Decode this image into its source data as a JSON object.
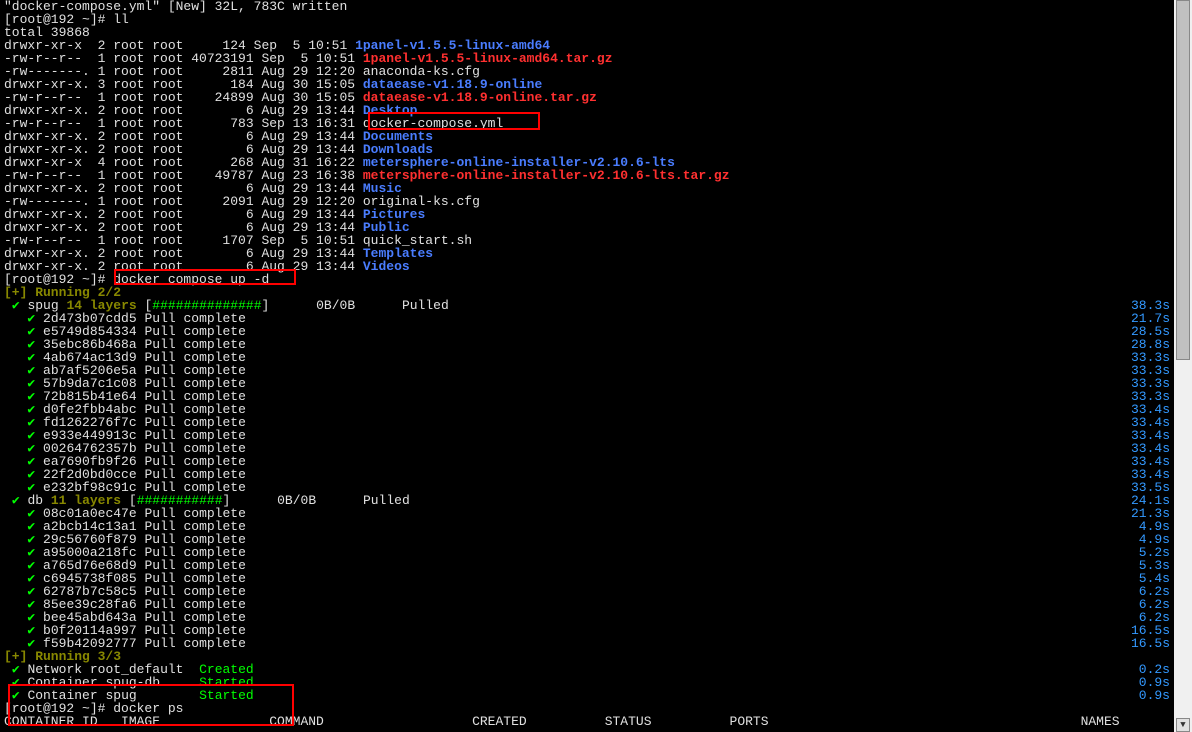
{
  "header": "\"docker-compose.yml\" [New] 32L, 783C written",
  "prompt1": "[root@192 ~]# ll",
  "total": "total 39868",
  "files": [
    {
      "perm": "drwxr-xr-x",
      "n": "2",
      "o": "root root",
      "sz": "    124",
      "dt": "Sep  5 10:51",
      "nm": "1panel-v1.5.5-linux-amd64",
      "c": "b"
    },
    {
      "perm": "-rw-r--r--",
      "n": "1",
      "o": "root root",
      "sz": "40723191",
      "dt": "Sep  5 10:51",
      "nm": "1panel-v1.5.5-linux-amd64.tar.gz",
      "c": "r"
    },
    {
      "perm": "-rw-------.",
      "n": "1",
      "o": "root root",
      "sz": "    2811",
      "dt": "Aug 29 12:20",
      "nm": "anaconda-ks.cfg",
      "c": "w"
    },
    {
      "perm": "drwxr-xr-x.",
      "n": "3",
      "o": "root root",
      "sz": "     184",
      "dt": "Aug 30 15:05",
      "nm": "dataease-v1.18.9-online",
      "c": "b"
    },
    {
      "perm": "-rw-r--r--",
      "n": "1",
      "o": "root root",
      "sz": "   24899",
      "dt": "Aug 30 15:05",
      "nm": "dataease-v1.18.9-online.tar.gz",
      "c": "r"
    },
    {
      "perm": "drwxr-xr-x.",
      "n": "2",
      "o": "root root",
      "sz": "       6",
      "dt": "Aug 29 13:44",
      "nm": "Desktop",
      "c": "b"
    },
    {
      "perm": "-rw-r--r--",
      "n": "1",
      "o": "root root",
      "sz": "     783",
      "dt": "Sep 13 16:31",
      "nm": "docker-compose.yml",
      "c": "w",
      "hl": 1
    },
    {
      "perm": "drwxr-xr-x.",
      "n": "2",
      "o": "root root",
      "sz": "       6",
      "dt": "Aug 29 13:44",
      "nm": "Documents",
      "c": "b"
    },
    {
      "perm": "drwxr-xr-x.",
      "n": "2",
      "o": "root root",
      "sz": "       6",
      "dt": "Aug 29 13:44",
      "nm": "Downloads",
      "c": "b"
    },
    {
      "perm": "drwxr-xr-x",
      "n": "4",
      "o": "root root",
      "sz": "     268",
      "dt": "Aug 31 16:22",
      "nm": "metersphere-online-installer-v2.10.6-lts",
      "c": "b"
    },
    {
      "perm": "-rw-r--r--",
      "n": "1",
      "o": "root root",
      "sz": "   49787",
      "dt": "Aug 23 16:38",
      "nm": "metersphere-online-installer-v2.10.6-lts.tar.gz",
      "c": "r"
    },
    {
      "perm": "drwxr-xr-x.",
      "n": "2",
      "o": "root root",
      "sz": "       6",
      "dt": "Aug 29 13:44",
      "nm": "Music",
      "c": "b"
    },
    {
      "perm": "-rw-------.",
      "n": "1",
      "o": "root root",
      "sz": "    2091",
      "dt": "Aug 29 12:20",
      "nm": "original-ks.cfg",
      "c": "w"
    },
    {
      "perm": "drwxr-xr-x.",
      "n": "2",
      "o": "root root",
      "sz": "       6",
      "dt": "Aug 29 13:44",
      "nm": "Pictures",
      "c": "b"
    },
    {
      "perm": "drwxr-xr-x.",
      "n": "2",
      "o": "root root",
      "sz": "       6",
      "dt": "Aug 29 13:44",
      "nm": "Public",
      "c": "b"
    },
    {
      "perm": "-rw-r--r--",
      "n": "1",
      "o": "root root",
      "sz": "    1707",
      "dt": "Sep  5 10:51",
      "nm": "quick_start.sh",
      "c": "w"
    },
    {
      "perm": "drwxr-xr-x.",
      "n": "2",
      "o": "root root",
      "sz": "       6",
      "dt": "Aug 29 13:44",
      "nm": "Templates",
      "c": "b"
    },
    {
      "perm": "drwxr-xr-x.",
      "n": "2",
      "o": "root root",
      "sz": "       6",
      "dt": "Aug 29 13:44",
      "nm": "Videos",
      "c": "b"
    }
  ],
  "prompt2_a": "[root@192 ~]# ",
  "prompt2_b": "docker compose up -d",
  "running": "[+] Running 2/2",
  "spug_hdr_a": "spug ",
  "spug_hdr_b": "14 layers",
  " spug_hdr_c": " [",
  "spug_hdr_bar": "##############",
  "spug_hdr_d": "]      0B/0B      Pulled",
  "spug_hdr_t": "38.3s",
  "layers_spug": [
    {
      "h": "2d473b07cdd5",
      "t": "21.7s"
    },
    {
      "h": "e5749d854334",
      "t": "28.5s"
    },
    {
      "h": "35ebc86b468a",
      "t": "28.8s"
    },
    {
      "h": "4ab674ac13d9",
      "t": "33.3s"
    },
    {
      "h": "ab7af5206e5a",
      "t": "33.3s"
    },
    {
      "h": "57b9da7c1c08",
      "t": "33.3s"
    },
    {
      "h": "72b815b41e64",
      "t": "33.3s"
    },
    {
      "h": "d0fe2fbb4abc",
      "t": "33.4s"
    },
    {
      "h": "fd1262276f7c",
      "t": "33.4s"
    },
    {
      "h": "e933e449913c",
      "t": "33.4s"
    },
    {
      "h": "00264762357b",
      "t": "33.4s"
    },
    {
      "h": "ea7690fb9f26",
      "t": "33.4s"
    },
    {
      "h": "22f2d0bd0cce",
      "t": "33.4s"
    },
    {
      "h": "e232bf98c91c",
      "t": "33.5s"
    }
  ],
  "db_hdr_a": "db ",
  "db_hdr_b": "11 layers",
  "db_hdr_c": " [",
  "db_hdr_bar": "###########",
  "db_hdr_d": "]      0B/0B      Pulled",
  "db_hdr_t": "24.1s",
  "layers_db": [
    {
      "h": "08c01a0ec47e",
      "t": "21.3s"
    },
    {
      "h": "a2bcb14c13a1",
      "t": "4.9s"
    },
    {
      "h": "29c56760f879",
      "t": "4.9s"
    },
    {
      "h": "a95000a218fc",
      "t": "5.2s"
    },
    {
      "h": "a765d76e68d9",
      "t": "5.3s"
    },
    {
      "h": "c6945738f085",
      "t": "5.4s"
    },
    {
      "h": "62787b7c58c5",
      "t": "6.2s"
    },
    {
      "h": "85ee39c28fa6",
      "t": "6.2s"
    },
    {
      "h": "bee45abd643a",
      "t": "6.2s"
    },
    {
      "h": "b0f20114a997",
      "t": "16.5s"
    },
    {
      "h": "f59b42092777",
      "t": "16.5s"
    }
  ],
  "pull_complete": "Pull complete",
  "running2": "[+] Running 3/3",
  "net": [
    {
      "n": "Network root_default",
      "s": "Created",
      "t": "0.2s"
    },
    {
      "n": "Container spug-db   ",
      "s": "Started",
      "t": "0.9s"
    },
    {
      "n": "Container spug      ",
      "s": "Started",
      "t": "0.9s"
    }
  ],
  "prompt3": "[root@192 ~]# docker ps",
  "ps_hdr": "CONTAINER ID   IMAGE              COMMAND                   CREATED          STATUS          PORTS                                        NAMES"
}
